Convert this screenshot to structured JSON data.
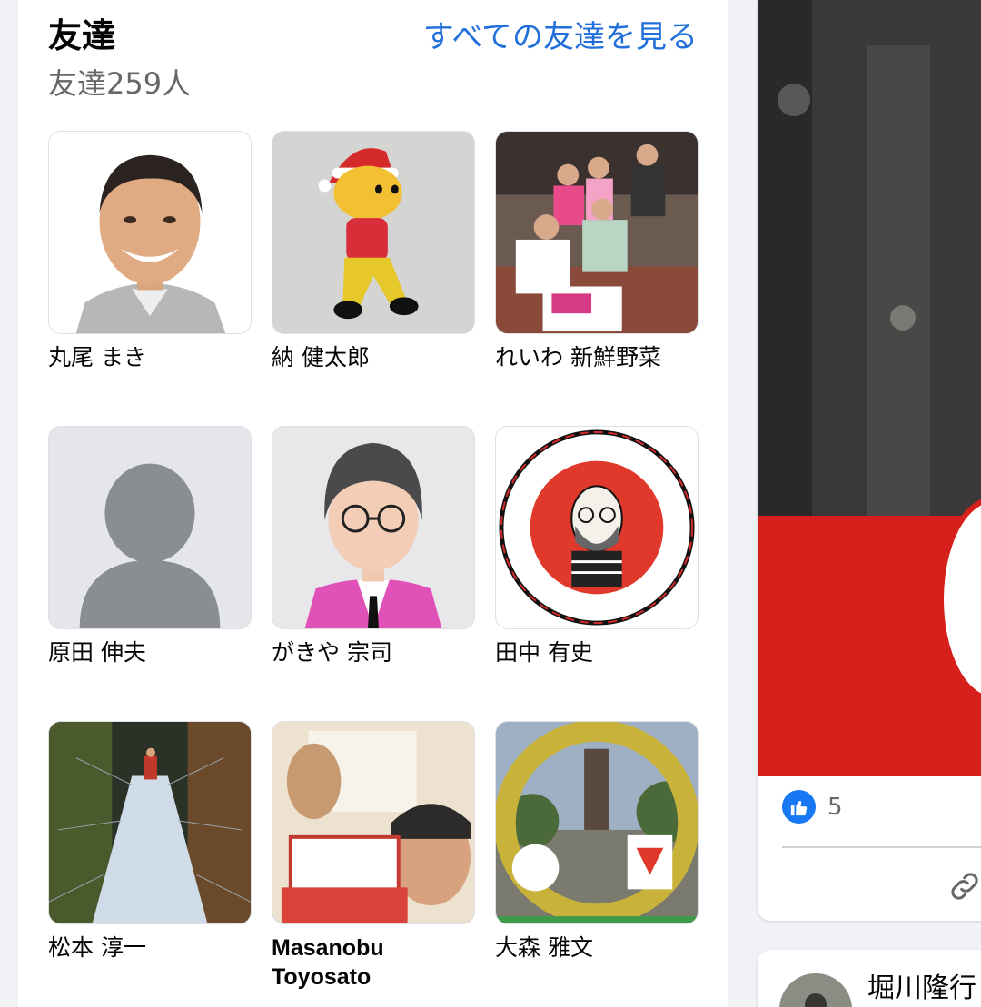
{
  "friends": {
    "title": "友達",
    "count_label": "友達259人",
    "see_all_label": "すべての友達を見る",
    "items": [
      {
        "name": "丸尾 まき"
      },
      {
        "name": "納 健太郎"
      },
      {
        "name": "れいわ 新鮮野菜"
      },
      {
        "name": "原田 伸夫"
      },
      {
        "name": "がきや 宗司"
      },
      {
        "name": "田中 有史"
      },
      {
        "name": "松本 淳一"
      },
      {
        "name": "Masanobu Toyosato"
      },
      {
        "name": "大森 雅文"
      }
    ]
  },
  "post": {
    "like_count": "5",
    "like_icon": "thumbs-up-icon",
    "share_icon": "link-icon"
  },
  "next_post": {
    "author": "堀川隆行"
  },
  "colors": {
    "link": "#216fdb",
    "like": "#1877f2",
    "muted": "#65676b"
  }
}
